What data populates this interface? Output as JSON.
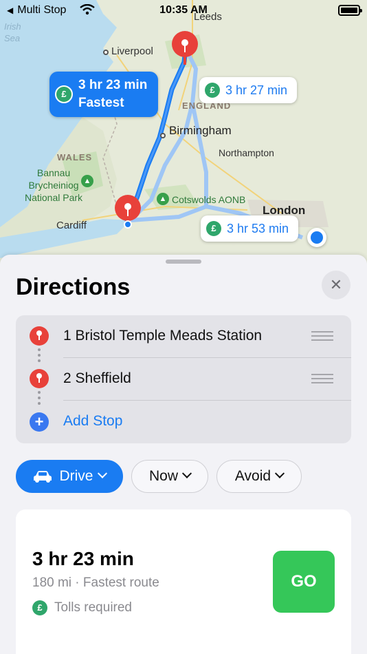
{
  "status_bar": {
    "back_label": "Multi Stop",
    "time": "10:35 AM"
  },
  "map": {
    "places": {
      "irish_sea": "Irish\nSea",
      "leeds": "Leeds",
      "liverpool": "Liverpool",
      "england": "ENGLAND",
      "birmingham": "Birmingham",
      "northampton": "Northampton",
      "wales": "WALES",
      "bannau": "Bannau\nBrycheiniog\nNational Park",
      "cotswolds": "Cotswolds AONB",
      "cardiff": "Cardiff",
      "london": "London"
    },
    "routes": [
      {
        "time": "3 hr 23 min",
        "label": "Fastest",
        "selected": true
      },
      {
        "time": "3 hr 27 min",
        "selected": false
      },
      {
        "time": "3 hr 53 min",
        "selected": false
      }
    ],
    "toll_symbol": "£",
    "colors": {
      "route_selected": "#1a7cf2",
      "route_alt": "#9fc6f5",
      "pin": "#e8413a"
    }
  },
  "sheet": {
    "title": "Directions",
    "close_symbol": "✕",
    "stops": [
      {
        "label": "1 Bristol Temple Meads Station"
      },
      {
        "label": "2 Sheffield"
      }
    ],
    "add_stop": {
      "symbol": "+",
      "label": "Add Stop"
    },
    "chips": {
      "drive": "Drive",
      "now": "Now",
      "avoid": "Avoid"
    },
    "route_card": {
      "time": "3 hr 23 min",
      "details": "180 mi · Fastest route",
      "toll_symbol": "£",
      "tolls": "Tolls required",
      "go_label": "GO"
    }
  }
}
